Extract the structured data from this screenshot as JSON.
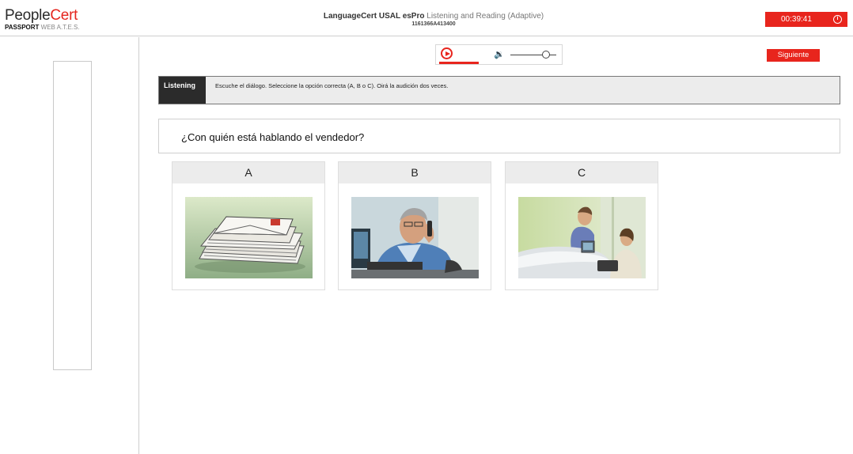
{
  "header": {
    "logo_people": "People",
    "logo_cert": "Cert",
    "logo_passport": "PASSPORT",
    "logo_web": "WEB A.T.E.S.",
    "exam_title_bold": "LanguageCert USAL esPro",
    "exam_title_rest": " Listening and Reading (Adaptive)",
    "exam_code": "1161366A413400",
    "timer": "00:39:41",
    "timer_icon": "info-icon"
  },
  "player": {
    "play_icon": "play-icon",
    "volume_icon": "volume-icon",
    "progress": 0.33,
    "volume": 0.75
  },
  "navigation": {
    "next_label": "Siguiente"
  },
  "instruction": {
    "section": "Listening",
    "text": "Escuche el diálogo. Seleccione la opción correcta (A, B o C). Oirá la audición dos veces."
  },
  "question": {
    "text": "¿Con quién está hablando el vendedor?"
  },
  "options": [
    {
      "letter": "A",
      "image": "stack-of-envelopes"
    },
    {
      "letter": "B",
      "image": "man-on-telephone-at-computer"
    },
    {
      "letter": "C",
      "image": "man-at-reception-desk-with-woman"
    }
  ],
  "colors": {
    "accent": "#e8251d",
    "instruction_label_bg": "#2b2b2b",
    "panel_bg": "#ececec"
  }
}
